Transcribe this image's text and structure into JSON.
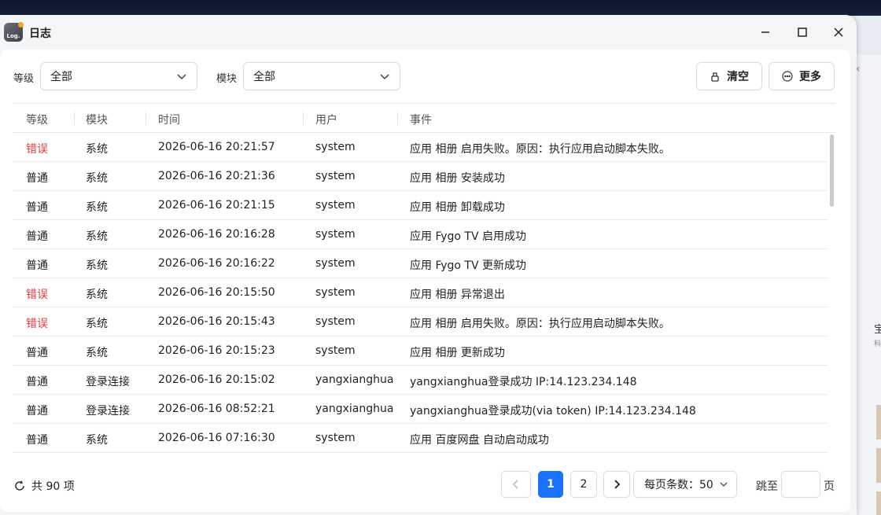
{
  "window": {
    "title": "日志",
    "icon_text": "Log."
  },
  "filters": {
    "level_label": "等级",
    "level_value": "全部",
    "module_label": "模块",
    "module_value": "全部"
  },
  "actions": {
    "clear_label": "清空",
    "more_label": "更多"
  },
  "table": {
    "headers": [
      "等级",
      "模块",
      "时间",
      "用户",
      "事件"
    ],
    "rows": [
      {
        "level": "错误",
        "error": true,
        "module": "系统",
        "time": "2026-06-16 20:21:57",
        "user": "system",
        "event": "应用 相册 启用失败。原因：执行应用启动脚本失败。"
      },
      {
        "level": "普通",
        "error": false,
        "module": "系统",
        "time": "2026-06-16 20:21:36",
        "user": "system",
        "event": "应用 相册 安装成功"
      },
      {
        "level": "普通",
        "error": false,
        "module": "系统",
        "time": "2026-06-16 20:21:15",
        "user": "system",
        "event": "应用 相册 卸载成功"
      },
      {
        "level": "普通",
        "error": false,
        "module": "系统",
        "time": "2026-06-16 20:16:28",
        "user": "system",
        "event": "应用 Fygo TV 启用成功"
      },
      {
        "level": "普通",
        "error": false,
        "module": "系统",
        "time": "2026-06-16 20:16:22",
        "user": "system",
        "event": "应用 Fygo TV 更新成功"
      },
      {
        "level": "错误",
        "error": true,
        "module": "系统",
        "time": "2026-06-16 20:15:50",
        "user": "system",
        "event": "应用 相册 异常退出"
      },
      {
        "level": "错误",
        "error": true,
        "module": "系统",
        "time": "2026-06-16 20:15:43",
        "user": "system",
        "event": "应用 相册 启用失败。原因：执行应用启动脚本失败。"
      },
      {
        "level": "普通",
        "error": false,
        "module": "系统",
        "time": "2026-06-16 20:15:23",
        "user": "system",
        "event": "应用 相册 更新成功"
      },
      {
        "level": "普通",
        "error": false,
        "module": "登录连接",
        "time": "2026-06-16 20:15:02",
        "user": "yangxianghua",
        "event": "yangxianghua登录成功 IP:14.123.234.148"
      },
      {
        "level": "普通",
        "error": false,
        "module": "登录连接",
        "time": "2026-06-16 08:52:21",
        "user": "yangxianghua",
        "event": "yangxianghua登录成功(via token) IP:14.123.234.148"
      },
      {
        "level": "普通",
        "error": false,
        "module": "系统",
        "time": "2026-06-16 07:16:30",
        "user": "system",
        "event": "应用 百度网盘 自动启动成功"
      }
    ]
  },
  "footer": {
    "total": "共 90 项",
    "pages": [
      "1",
      "2"
    ],
    "current_page": "1",
    "page_size": "每页条数：50",
    "jump_label": "跳至",
    "jump_value": "",
    "page_suffix": "页"
  },
  "background": {
    "text1": "宝",
    "text2": "科"
  },
  "colors": {
    "accent": "#1a73ff",
    "error": "#e23c3c"
  }
}
